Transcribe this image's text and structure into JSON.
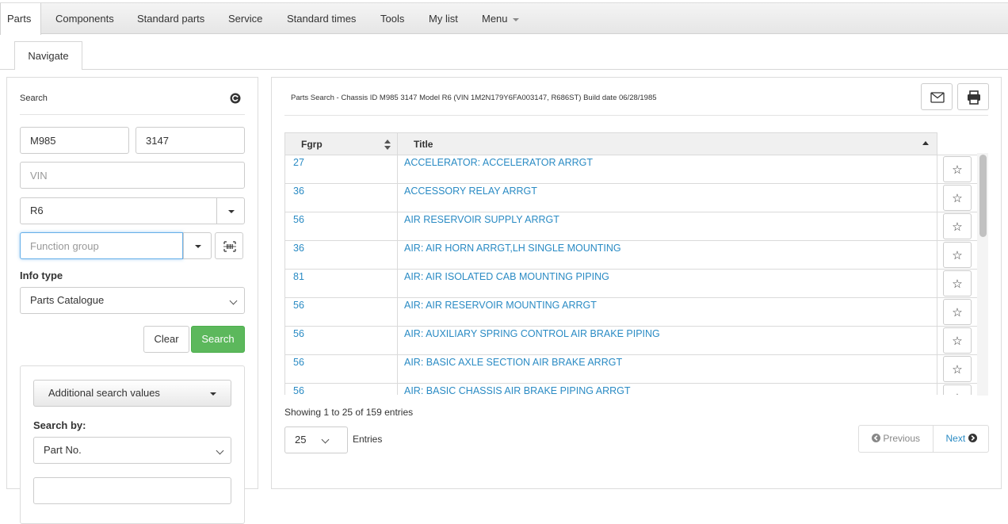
{
  "nav": {
    "items": [
      "Parts",
      "Components",
      "Standard parts",
      "Service",
      "Standard times",
      "Tools",
      "My list",
      "Menu"
    ]
  },
  "subtab": {
    "label": "Navigate"
  },
  "search_panel": {
    "title": "Search",
    "model_prefix": "M985",
    "chassis_no": "3147",
    "vin_placeholder": "VIN",
    "model": "R6",
    "function_group_placeholder": "Function group",
    "info_type_label": "Info type",
    "info_type": "Parts Catalogue",
    "clear_label": "Clear",
    "search_label": "Search",
    "additional_label": "Additional search values",
    "search_by_label": "Search by:",
    "search_by": "Part No."
  },
  "results": {
    "header": "Parts Search - Chassis ID M985 3147 Model R6 (VIN 1M2N179Y6FA003147, R686ST) Build date 06/28/1985",
    "columns": [
      "Fgrp",
      "Title"
    ],
    "rows": [
      {
        "fgrp": "27",
        "title": "ACCELERATOR: ACCELERATOR ARRGT"
      },
      {
        "fgrp": "36",
        "title": "ACCESSORY RELAY ARRGT"
      },
      {
        "fgrp": "56",
        "title": "AIR RESERVOIR SUPPLY ARRGT"
      },
      {
        "fgrp": "36",
        "title": "AIR: AIR HORN ARRGT,LH SINGLE MOUNTING"
      },
      {
        "fgrp": "81",
        "title": "AIR: AIR ISOLATED CAB MOUNTING PIPING"
      },
      {
        "fgrp": "56",
        "title": "AIR: AIR RESERVOIR MOUNTING ARRGT"
      },
      {
        "fgrp": "56",
        "title": "AIR: AUXILIARY SPRING CONTROL AIR BRAKE PIPING"
      },
      {
        "fgrp": "56",
        "title": "AIR: BASIC AXLE SECTION AIR BRAKE ARRGT"
      },
      {
        "fgrp": "56",
        "title": "AIR: BASIC CHASSIS AIR BRAKE PIPING ARRGT"
      }
    ],
    "showing": "Showing 1 to 25 of 159 entries",
    "page_length": "25",
    "entries_label": "Entries",
    "previous_label": "Previous",
    "next_label": "Next",
    "star_glyph": "☆",
    "scroll_position": 0.0
  },
  "colors": {
    "link": "#2a8bc4",
    "success": "#5cb85c"
  }
}
